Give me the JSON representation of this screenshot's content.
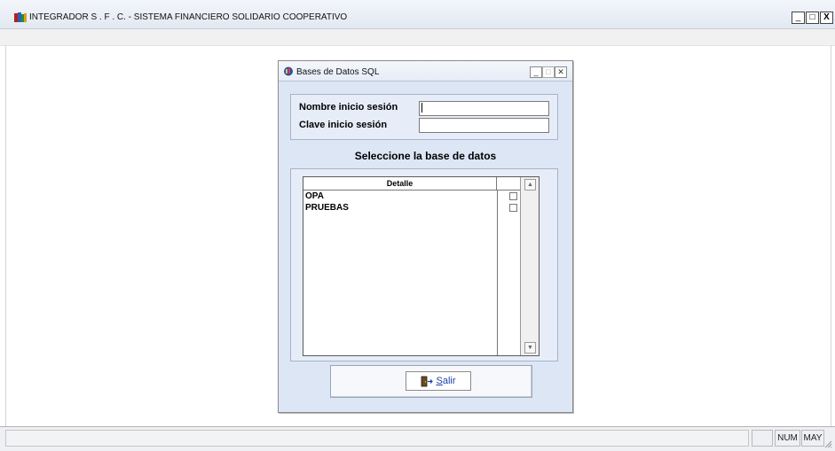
{
  "app": {
    "title": "INTEGRADOR  S . F . C. - SISTEMA FINANCIERO SOLIDARIO COOPERATIVO",
    "minimize": "_",
    "maximize": "□",
    "close": "X"
  },
  "dialog": {
    "title": "Bases de Datos SQL",
    "minimize": "_",
    "maximize": "□",
    "close": "✕",
    "login": {
      "user_label": "Nombre inicio sesión",
      "user_value": "",
      "password_label": "Clave inicio sesión",
      "password_value": ""
    },
    "select_title": "Seleccione la base de datos",
    "grid": {
      "column_detalle": "Detalle",
      "rows": [
        {
          "name": "OPA",
          "checked": false
        },
        {
          "name": "PRUEBAS",
          "checked": false
        }
      ]
    },
    "exit_button": {
      "hotkey": "S",
      "rest": "alir"
    }
  },
  "statusbar": {
    "num": "NUM",
    "may": "MAY"
  },
  "colors": {
    "dialog_bg": "#dde6f5",
    "exit_label": "#1a3ea6"
  }
}
